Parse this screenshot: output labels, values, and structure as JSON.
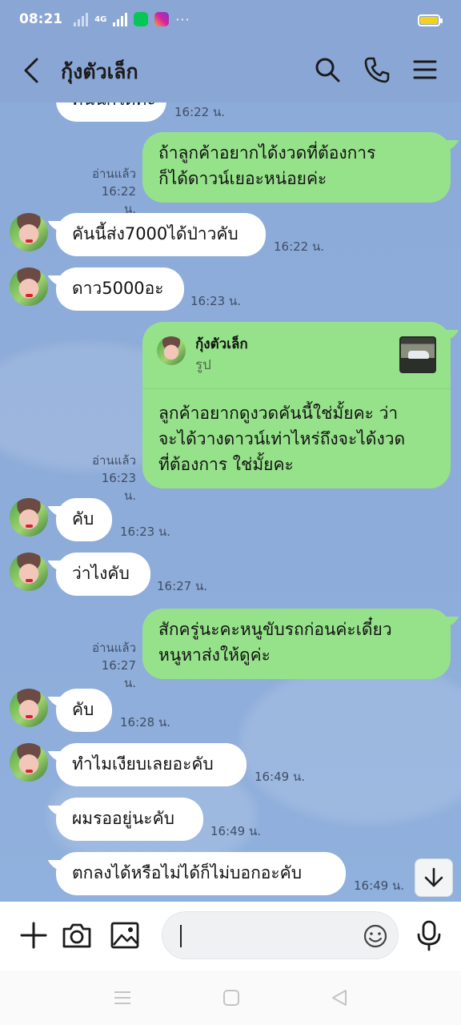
{
  "status_bar": {
    "time": "08:21",
    "network_type": "4G",
    "apps": [
      "line-icon",
      "instagram-icon"
    ],
    "overflow": "···",
    "battery_color": "#f4d21b"
  },
  "header": {
    "title": "กุ้งตัวเล็ก",
    "icons": [
      "back-icon",
      "search-icon",
      "phone-icon",
      "menu-icon"
    ]
  },
  "chat": {
    "partial_top": {
      "text": "คันนี้ก็ได้ค่ะ",
      "time": "16:22 น."
    },
    "messages": [
      {
        "dir": "out",
        "lines": [
          "ถ้าลูกค้าอยากได้งวดที่ต้องการ",
          "ก็ได้ดาวน์เยอะหน่อยค่ะ"
        ],
        "read": "อ่านแล้ว",
        "time": "16:22 น."
      },
      {
        "dir": "in",
        "text": "คันนี้ส่ง7000ได้ป่าวคับ",
        "time": "16:22 น."
      },
      {
        "dir": "in",
        "text": "ดาว5000อะ",
        "time": "16:23 น."
      },
      {
        "dir": "out",
        "reply": {
          "name": "กุ้งตัวเล็ก",
          "type": "รูป"
        },
        "lines": [
          "ลูกค้าอยากดูงวดคันนี้ใช่มั้ยคะ ว่า",
          "จะได้วางดาวน์เท่าไหร่ถึงจะได้งวด",
          "ที่ต้องการ ใช่มั้ยคะ"
        ],
        "read": "อ่านแล้ว",
        "time": "16:23 น."
      },
      {
        "dir": "in",
        "text": "คับ",
        "time": "16:23 น."
      },
      {
        "dir": "in",
        "text": "ว่าไงคับ",
        "time": "16:27 น."
      },
      {
        "dir": "out",
        "lines": [
          "สักครู่นะคะหนูขับรถก่อนค่ะเดี๋ยว",
          "หนูหาส่งให้ดูค่ะ"
        ],
        "read": "อ่านแล้ว",
        "time": "16:27 น."
      },
      {
        "dir": "in",
        "text": "คับ",
        "time": "16:28 น."
      },
      {
        "dir": "in",
        "text": "ทำไมเงียบเลยอะคับ",
        "time": "16:49 น."
      },
      {
        "dir": "in",
        "text": "ผมรออยู่นะคับ",
        "time": "16:49 น."
      },
      {
        "dir": "in",
        "text": "ตกลงได้หรือไม่ได้ก็ไม่บอกอะคับ",
        "time": "16:49 น."
      }
    ]
  },
  "input_bar": {
    "placeholder": "",
    "icons": [
      "plus-icon",
      "camera-icon",
      "image-icon",
      "emoji-icon",
      "microphone-icon"
    ]
  },
  "nav_bar": {
    "icons": [
      "recent-apps-icon",
      "home-icon",
      "back-nav-icon"
    ]
  },
  "colors": {
    "chat_background": "#8cabd9",
    "incoming_bubble": "#ffffff",
    "outgoing_bubble": "#96e28a",
    "header_background": "#8aa6d4"
  }
}
